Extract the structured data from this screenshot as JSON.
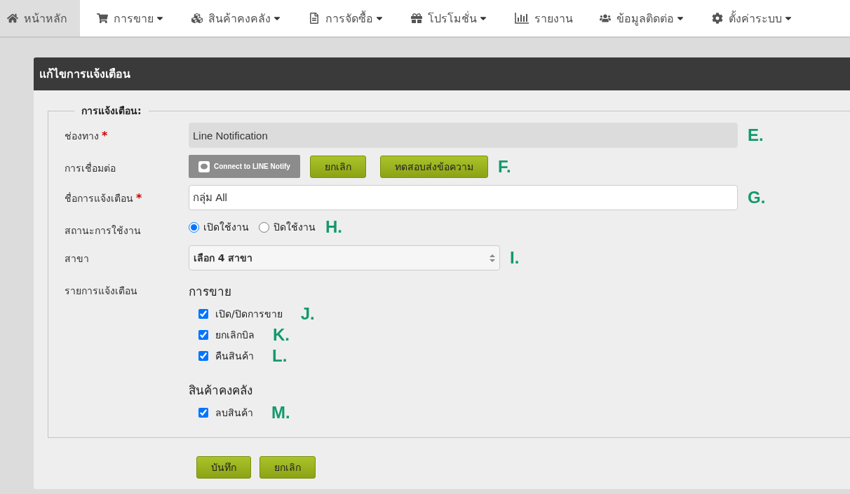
{
  "nav": [
    {
      "label": "หน้าหลัก",
      "selected": true,
      "dropdown": false
    },
    {
      "label": "การขาย",
      "selected": false,
      "dropdown": true
    },
    {
      "label": "สินค้าคงคลัง",
      "selected": false,
      "dropdown": true
    },
    {
      "label": "การจัดซื้อ",
      "selected": false,
      "dropdown": true
    },
    {
      "label": "โปรโมชั่น",
      "selected": false,
      "dropdown": true
    },
    {
      "label": "รายงาน",
      "selected": false,
      "dropdown": false
    },
    {
      "label": "ข้อมูลติดต่อ",
      "selected": false,
      "dropdown": true
    },
    {
      "label": "ตั้งค่าระบบ",
      "selected": false,
      "dropdown": true
    }
  ],
  "panel": {
    "title": "แก้ไขการแจ้งเตือน",
    "legend": "การแจ้งเตือน:",
    "rows": [
      {
        "kind": "readonly",
        "label": "ช่องทาง",
        "required_mark": "*",
        "value": "Line Notification",
        "annotation": "E."
      },
      {
        "kind": "buttons",
        "label": "การเชื่อมต่อ",
        "connect": "Connect to LINE Notify",
        "buttons": [
          "ยกเลิก",
          "ทดสอบส่งข้อความ"
        ],
        "annotation": "F."
      },
      {
        "kind": "input",
        "label": "ชื่อการแจ้งเตือน",
        "required_mark": "*",
        "value": "กลุ่ม All",
        "annotation": "G."
      },
      {
        "kind": "radio",
        "label": "สถานะการใช้งาน",
        "options": [
          {
            "label": "เปิดใช้งาน",
            "selected": true
          },
          {
            "label": "ปิดใช้งาน",
            "selected": false
          }
        ],
        "annotation": "H."
      },
      {
        "kind": "select",
        "label": "สาขา",
        "value": "เลือก 4 สาขา",
        "annotation": "I."
      },
      {
        "kind": "checklist",
        "label": "รายการแจ้งเตือน",
        "groups": [
          {
            "title": "การขาย",
            "items": [
              {
                "label": "เปิด/ปิดการขาย",
                "checked": true,
                "annotation": "J."
              },
              {
                "label": "ยกเลิกบิล",
                "checked": true,
                "annotation": "K."
              },
              {
                "label": "คืนสินค้า",
                "checked": true,
                "annotation": "L."
              }
            ]
          },
          {
            "title": "สินค้าคงคลัง",
            "items": [
              {
                "label": "ลบสินค้า",
                "checked": true,
                "annotation": "M."
              }
            ]
          }
        ]
      }
    ]
  },
  "footer_buttons": [
    "บันทึก",
    "ยกเลิก"
  ]
}
